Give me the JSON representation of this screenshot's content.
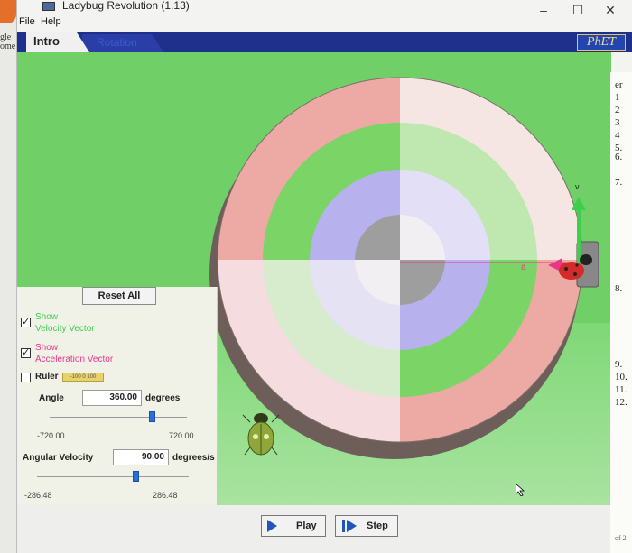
{
  "window": {
    "title": "Ladybug Revolution (1.13)",
    "controls": {
      "minimize": "–",
      "maximize": "☐",
      "close": "✕"
    }
  },
  "menu": {
    "file": "File",
    "help": "Help"
  },
  "tabs": {
    "intro": "Intro",
    "rotation": "Rotation",
    "logo": "PhET"
  },
  "left_edge_fragments": [
    "gle",
    "ome"
  ],
  "scene": {
    "vector_labels": {
      "velocity": "v",
      "acceleration": "a"
    },
    "colors": {
      "velocity_vector": "#3ecf4a",
      "acceleration_vector": "#e8378a",
      "background": "#70d067"
    }
  },
  "panel": {
    "reset_label": "Reset All",
    "show_velocity": {
      "line1": "Show",
      "line2": "Velocity Vector",
      "checked": true
    },
    "show_acceleration": {
      "line1": "Show",
      "line2": "Acceleration Vector",
      "checked": true
    },
    "ruler": {
      "label": "Ruler",
      "checked": false,
      "ticks": "-100   0   100"
    },
    "angle": {
      "label": "Angle",
      "value": "360.00",
      "unit": "degrees",
      "min": "-720.00",
      "max": "720.00",
      "level": 0.75
    },
    "angular_velocity": {
      "label": "Angular Velocity",
      "value": "90.00",
      "unit": "degrees/s",
      "min": "-286.48",
      "max": "286.48",
      "level": 0.657
    }
  },
  "controls": {
    "play": "Play",
    "step": "Step"
  },
  "doc_fragment": {
    "items": [
      "er",
      "1",
      "2",
      "3",
      "4",
      "5.",
      "6.",
      "7.",
      "8.",
      "9.",
      "10.",
      "11.",
      "12."
    ],
    "page": "of 2"
  }
}
